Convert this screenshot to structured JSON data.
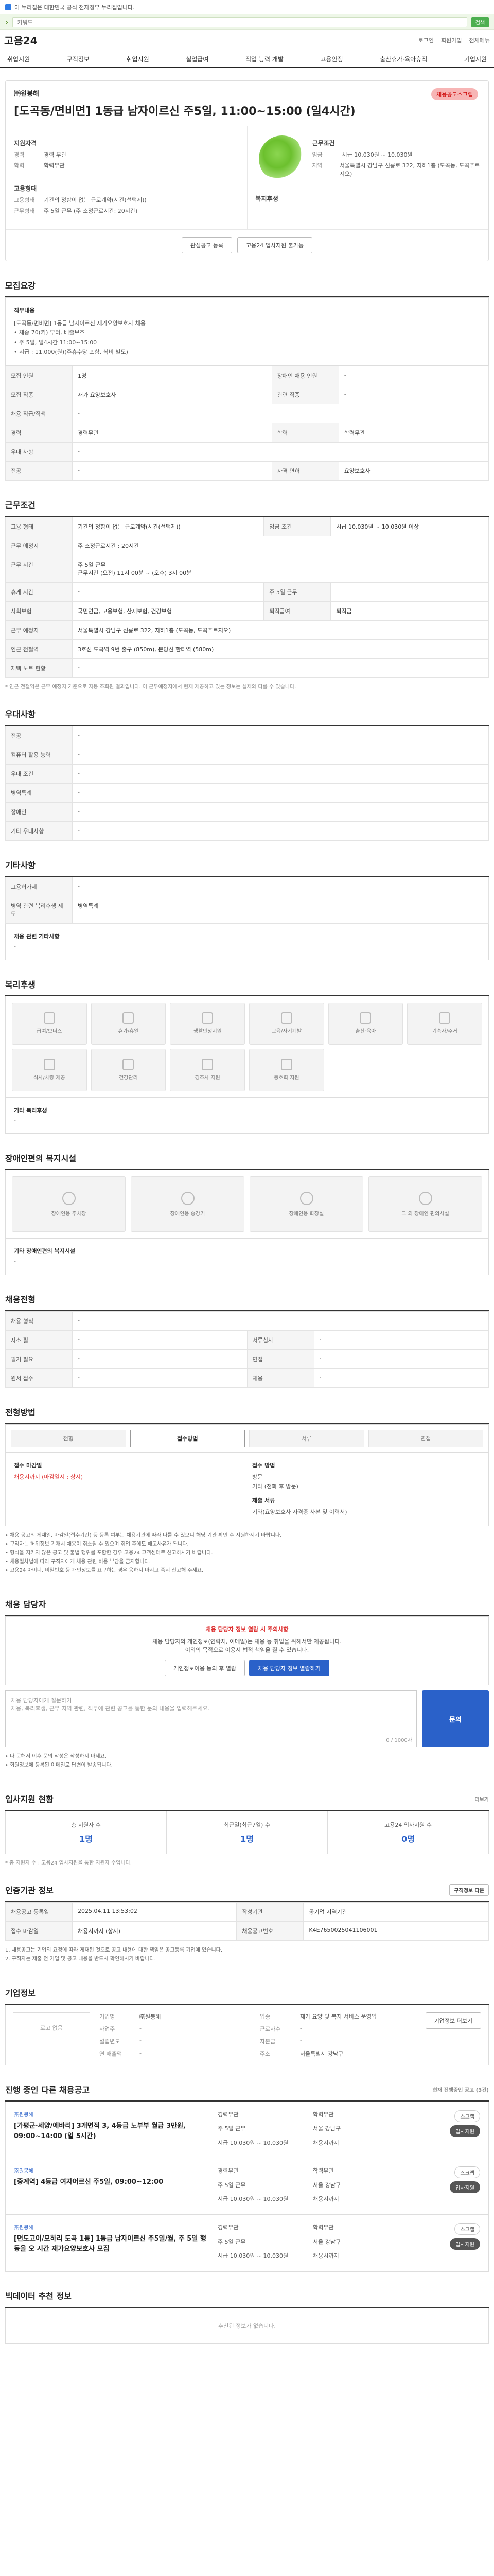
{
  "topbar": {
    "text": "이 누리집은 대한민국 공식 전자정부 누리집입니다."
  },
  "greenbar": {
    "placeholder": "키워드",
    "go": "검색"
  },
  "header": {
    "logo": "고용24",
    "links": [
      "로그인",
      "회원가입",
      "전체메뉴"
    ]
  },
  "nav": [
    "취업지원",
    "구직정보",
    "취업지원",
    "실업급여",
    "직업 능력 개발",
    "고용안정",
    "출산휴가·육아휴직",
    "기업지원"
  ],
  "job": {
    "company": "㈜원봉해",
    "title": "[도곡동/면비면] 1동급 남자이르신 주5일, 11:00~15:00 (일4시간)",
    "scrap": "채용공고스크랩",
    "left_label": "지원자격",
    "left_rows": [
      {
        "k": "경력",
        "v": "경력 무관"
      },
      {
        "k": "학력",
        "v": "학력무관"
      }
    ],
    "left_label2": "고용형태",
    "left_rows2": [
      {
        "k": "고용형태",
        "v": "기간의 정함이 없는 근로계약(시간(선택제))"
      },
      {
        "k": "근무형태",
        "v": "주 5일 근무 (주 소정근로시간: 20시간)"
      }
    ],
    "right_label": "근무조건",
    "right_rows": [
      {
        "k": "임금",
        "v": "시급 10,030원 ~ 10,030원"
      },
      {
        "k": "지역",
        "v": "서울특별시 강남구 선릉로 322, 지하1층 (도곡동, 도곡푸르지오)"
      }
    ],
    "right_label2": "복지후생",
    "actions": [
      "관심공고 등록",
      "고용24 입사지원 불가능"
    ]
  },
  "recruit": {
    "title": "모집요강",
    "content_label": "직무내용",
    "content": "[도곡동/면비면] 1동급 남자이르신 재가요양보호사 채용\n• 체중 70(키) 부터, 배출보조\n• 주 5일, 일4시간 11:00~15:00\n• 시급 : 11,000(원)(주휴수당 포함, 식비 별도)",
    "rows": [
      [
        "모집 인원",
        "1명",
        "장애인 채용 인원",
        "-"
      ],
      [
        "모집 직종",
        "재가 요양보호사",
        "관련 직종",
        "-"
      ],
      [
        "채용 직급/직책",
        "-",
        "",
        ""
      ],
      [
        "경력",
        "경력무관",
        "학력",
        "학력무관"
      ],
      [
        "우대 사항",
        "-",
        "",
        ""
      ],
      [
        "전공",
        "-",
        "자격 면허",
        "요양보호사"
      ]
    ]
  },
  "conditions": {
    "title": "근무조건",
    "rows": [
      [
        "고용 형태",
        "기간의 정함이 없는 근로계약(시간(선택제))",
        "임금 조건",
        "시급 10,030원 ~ 10,030원 이상"
      ],
      [
        "근무 예정지",
        "주 소정근로시간 : 20시간",
        "",
        ""
      ],
      [
        "근무 시간",
        "주 5일 근무\n근무시간 (오전) 11시 00분 ~ (오후) 3시 00분",
        "",
        ""
      ],
      [
        "휴게 시간",
        "-",
        "주 5일 근무",
        ""
      ],
      [
        "사회보험",
        "국민연금, 고용보험, 산재보험, 건강보험",
        "퇴직급여",
        "퇴직금"
      ],
      [
        "근무 예정지",
        "서울특별시 강남구 선릉로 322, 지하1층 (도곡동, 도곡푸르지오)",
        "",
        ""
      ],
      [
        "인근 전철역",
        "3호선 도곡역 9번 출구 (850m), 분당선 한티역 (580m)",
        "",
        ""
      ],
      [
        "재택 노트 현황",
        "-",
        "",
        ""
      ]
    ],
    "footnote": "* 인근 전철역은 근무 예정지 기준으로 자동 조회된 결과입니다. 이 근무예정지에서 현재 제공하고 있는 정보는 실제와 다를 수 있습니다."
  },
  "preferences": {
    "title": "우대사항",
    "rows": [
      [
        "전공",
        "-"
      ],
      [
        "컴퓨터 활용 능력",
        "-"
      ],
      [
        "우대 조건",
        "-"
      ],
      [
        "병역특례",
        "-"
      ],
      [
        "장애인",
        "-"
      ],
      [
        "기타 우대사항",
        "-"
      ]
    ]
  },
  "etc": {
    "title": "기타사항",
    "rows": [
      [
        "고용허가제",
        "-"
      ],
      [
        "병역 관련 복리후생 제도",
        "병역특례"
      ]
    ],
    "note_label": "채용 관련 기타사항",
    "note": "-"
  },
  "benefits": {
    "title": "복리후생",
    "icons": [
      "급여/보너스",
      "휴가/휴일",
      "생활안정지원",
      "교육/자기계발",
      "출산·육아",
      "기숙사/주거",
      "식사/차량 제공",
      "건강관리",
      "경조사 지원",
      "동호회 지원"
    ],
    "other_label": "기타 복리후생",
    "other": "-"
  },
  "disability": {
    "title": "장애인편의 복지시설",
    "icons": [
      "장애인용 주차장",
      "장애인용 승강기",
      "장애인용 화장실",
      "그 외 장애인 편의시설"
    ],
    "other_label": "기타 장애인편의 복지시설",
    "other": "-"
  },
  "hiring": {
    "title": "채용전형",
    "rows": [
      [
        "채용 형식",
        "-",
        "",
        ""
      ],
      [
        "자소 필",
        "-",
        "서류심사",
        "-"
      ],
      [
        "필기 필요",
        "-",
        "면접",
        "-"
      ],
      [
        "원서 접수",
        "-",
        "채용",
        "-"
      ]
    ]
  },
  "application": {
    "title": "전형방법",
    "tabs": [
      "전형",
      "접수방법",
      "서류",
      "면접"
    ],
    "left_label": "접수 마감일",
    "left_value": "채용시까지 (마감일시 : 상시)",
    "right_label": "접수 방법",
    "right_lines": [
      "방문",
      "기타 (전화 후 방문)"
    ],
    "right_label2": "제출 서류",
    "right_value2": "기타(요양보호사 자격증 사본 및 이력서)",
    "notices": [
      "• 채용 공고의 게재일, 마감일(접수기간) 등 등록 여부는 채용기관에 따라 다를 수 있으니 해당 기관 확인 후 지원하시기 바랍니다.",
      "• 구직자는 허위정보 기재시 채용이 취소될 수 있으며 취업 후에도 해고사유가 됩니다.",
      "• 형식을 지키지 않은 공고 및 불법 행위를 포함한 경우 고용24 고객센터로 신고하시기 바랍니다.",
      "• 채용절차법에 따라 구직자에게 채용 관련 비용 부담을 금지합니다.",
      "• 고용24 아이디, 비밀번호 등 개인정보를 요구하는 경우 응하지 마시고 즉시 신고해 주세요."
    ]
  },
  "contact": {
    "title": "채용 담당자",
    "warn": "채용 담당자 정보 열람 시 주의사항",
    "lines": [
      "채용 담당자의 개인정보(연락처, 이메일)는 채용 등 취업을 위해서만 제공됩니다.",
      "이외의 목적으로 이용시 법적 책임을 질 수 있습니다."
    ],
    "btn1": "개인정보이용 동의 후 열람",
    "btn2": "채용 담당자 정보 열람하기",
    "inquiry_placeholder": "채용 담당자에게 질문하기\n채용, 복리후생, 근무 지역 관련, 직무에 관련 공고를 통한 문의 내용을 입력해주세요.",
    "inquiry_count": "0 / 1000자",
    "inquiry_btn": "문의",
    "notes": [
      "• 다 문해서 이후 문의 작성은 작성하지 마세요.",
      "• 회원정보에 등록된 이메일로 답변이 발송됩니다."
    ]
  },
  "status": {
    "title": "입사지원 현황",
    "link": "더보기",
    "items": [
      {
        "label": "총 지원자 수",
        "value": "1명"
      },
      {
        "label": "최근일(최근7일) 수",
        "value": "1명"
      },
      {
        "label": "고용24 입사지원 수",
        "value": "0명"
      }
    ],
    "note": "* 총 지원자 수 : 고용24 입사지원을 통한 지원자 수입니다."
  },
  "info": {
    "title": "인증기관 정보",
    "link": "구직정보 다운",
    "rows": [
      [
        "채용공고 등록일",
        "2025.04.11 13:53:02",
        "작성기관",
        "공기업 지역기관"
      ],
      [
        "접수 마감일",
        "채용시까지 (상시)",
        "채용공고번호",
        "K4E7650025041106001"
      ]
    ],
    "notes": [
      "1. 채용공고는 기업의 요청에 따라 게재된 것으로 공고 내용에 대한 책임은 공고등록 기업에 있습니다.",
      "2. 구직자는 제출 전 기업 및 공고 내용을 반드시 확인하시기 바랍니다."
    ]
  },
  "company": {
    "title": "기업정보",
    "logo": "로고 없음",
    "rows": [
      [
        "기업명",
        "㈜원봉해",
        "업종",
        "재가 요양 및 복지 서비스 운영업"
      ],
      [
        "사업주",
        "-",
        "근로자수",
        "-"
      ],
      [
        "설립년도",
        "-",
        "자본금",
        "-"
      ],
      [
        "연 매출액",
        "-",
        "주소",
        "서울특별시 강남구"
      ]
    ],
    "btn": "기업정보 더보기"
  },
  "other_jobs": {
    "title": "진행 중인 다른 채용공고",
    "subtitle": "현재 진행중인 공고 (3건)",
    "items": [
      {
        "co": "㈜원봉해",
        "title": "[가평군·세양/에바리] 3개면적 3, 4등급 노부부 월급 3만원, 09:00~14:00 (일 5시간)",
        "tags": [
          "경력무관",
          "학력무관",
          "주 5일 근무",
          "서울 강남구",
          "시급 10,030원 ~ 10,030원"
        ],
        "deadline": "채용시까지",
        "buttons": [
          "스크랩",
          "입사지원"
        ]
      },
      {
        "co": "㈜원봉해",
        "title": "[중계역] 4등급 여자어르신 주5일, 09:00~12:00",
        "tags": [
          "경력무관",
          "학력무관",
          "주 5일 근무",
          "서울 강남구",
          "시급 10,030원 ~ 10,030원"
        ],
        "deadline": "채용시까지",
        "buttons": [
          "스크랩",
          "입사지원"
        ]
      },
      {
        "co": "㈜원봉해",
        "title": "[면도고이/모하리 도곡 1동] 1동급 남자이르신 주5일/월, 주 5일 행동을 오 시간 재가요양보호사 모집",
        "tags": [
          "경력무관",
          "학력무관",
          "주 5일 근무",
          "서울 강남구",
          "시급 10,030원 ~ 10,030원"
        ],
        "deadline": "채용시까지",
        "buttons": [
          "스크랩",
          "입사지원"
        ]
      }
    ]
  },
  "recent": {
    "title": "빅데이터 추천 정보",
    "empty": "추천된 정보가 없습니다."
  }
}
